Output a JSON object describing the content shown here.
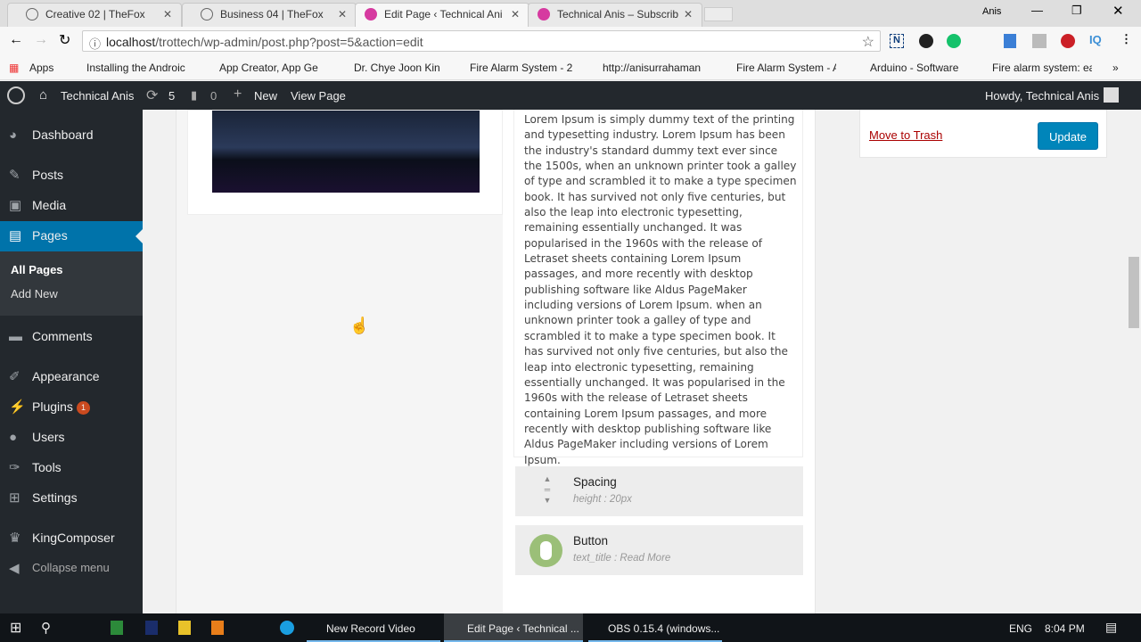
{
  "browser": {
    "tabs": [
      {
        "label": "Creative 02 | TheFox"
      },
      {
        "label": "Business 04 | TheFox"
      },
      {
        "label": "Edit Page ‹ Technical Ani"
      },
      {
        "label": "Technical Anis – Subscrib"
      }
    ],
    "profile": "Anis",
    "url_host": "localhost",
    "url_rest": "/trottech/wp-admin/post.php?post=5&action=edit",
    "bookmarks": [
      "Apps",
      "Installing the Androic",
      "App Creator, App Ge",
      "Dr. Chye Joon Kin",
      "Fire Alarm System - 2",
      "http://anisurrahaman",
      "Fire Alarm System - A",
      "Arduino - Software",
      "Fire alarm system: ea"
    ]
  },
  "adminbar": {
    "site": "Technical Anis",
    "updates": "5",
    "comments": "0",
    "new": "New",
    "view": "View Page",
    "howdy": "Howdy, Technical Anis"
  },
  "sidebar": {
    "items": [
      "Dashboard",
      "Posts",
      "Media",
      "Pages",
      "Comments",
      "Appearance",
      "Plugins",
      "Users",
      "Tools",
      "Settings",
      "KingComposer",
      "Collapse menu"
    ],
    "plugins_badge": "1",
    "sub": [
      "All Pages",
      "Add New"
    ]
  },
  "content": {
    "lorem": "Lorem Ipsum is simply dummy text of the printing and typesetting industry. Lorem Ipsum has been the industry's standard dummy text ever since the 1500s, when an unknown printer took a galley of type and scrambled it to make a type specimen book. It has survived not only five centuries, but also the leap into electronic typesetting, remaining essentially unchanged. It was popularised in the 1960s with the release of Letraset sheets containing Lorem Ipsum passages, and more recently with desktop publishing software like Aldus PageMaker including versions of Lorem Ipsum. when an unknown printer took a galley of type and scrambled it to make a type specimen book. It has survived not only five centuries, but also the leap into electronic typesetting, remaining essentially unchanged. It was popularised in the 1960s with the release of Letraset sheets containing Lorem Ipsum passages, and more recently with desktop publishing software like Aldus PageMaker including versions of Lorem Ipsum.",
    "elements": [
      {
        "title": "Spacing",
        "desc": "height : 20px"
      },
      {
        "title": "Button",
        "desc": "text_title : Read More"
      }
    ]
  },
  "publish": {
    "trash": "Move to Trash",
    "update": "Update"
  },
  "taskbar": {
    "items": [
      "New Record Video",
      "Edit Page ‹ Technical ...",
      "OBS 0.15.4 (windows..."
    ],
    "lang": "ENG",
    "time": "8:04 PM"
  }
}
